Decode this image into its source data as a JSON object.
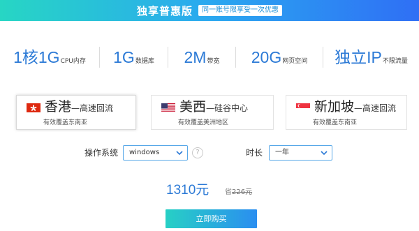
{
  "banner": {
    "title": "独享普惠版",
    "badge": "同一账号限享受一次优惠"
  },
  "specs": [
    {
      "big": "1核1G",
      "small": "CPU内存"
    },
    {
      "big": "1G",
      "small": "数据库"
    },
    {
      "big": "2M",
      "small": "带宽"
    },
    {
      "big": "20G",
      "small": "网页空间"
    },
    {
      "big": "独立IP",
      "small": "不限流量"
    }
  ],
  "regions": [
    {
      "name": "香港",
      "suffix": "—高速回流",
      "sub": "有效覆盖东南亚",
      "flag": "hong-kong-flag-icon",
      "selected": true
    },
    {
      "name": "美西",
      "suffix": "—硅谷中心",
      "sub": "有效覆盖美洲地区",
      "flag": "usa-flag-icon",
      "selected": false
    },
    {
      "name": "新加坡",
      "suffix": "—高速回流",
      "sub": "有效覆盖东南亚",
      "flag": "singapore-flag-icon",
      "selected": false
    }
  ],
  "os": {
    "label": "操作系统",
    "value": "windows",
    "help": "?"
  },
  "duration": {
    "label": "时长",
    "value": "一年"
  },
  "price": {
    "value": "1310元",
    "save_prefix": "省",
    "save_amount": "226元"
  },
  "buy_label": "立即购买",
  "colors": {
    "accent": "#2c7ad6",
    "banner_start": "#27d6c4",
    "banner_end": "#2f6ff5",
    "select_border": "#58a8e8"
  }
}
